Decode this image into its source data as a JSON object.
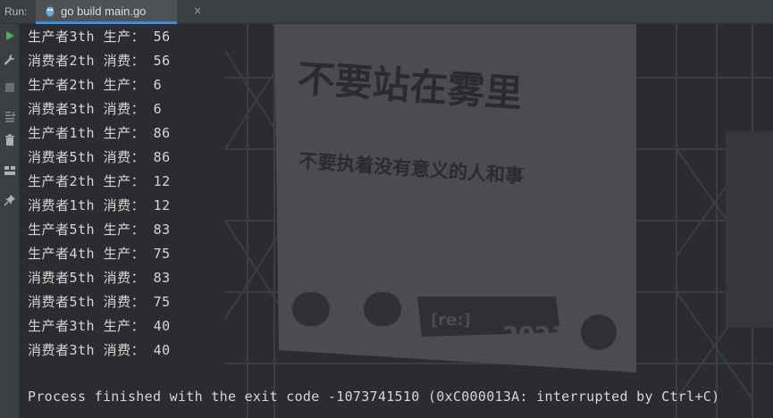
{
  "run_header": {
    "label": "Run:",
    "tab_title": "go build main.go",
    "close": "×"
  },
  "toolbar": {
    "buttons": [
      {
        "icon": "run-icon",
        "color": "#4caf50"
      },
      {
        "icon": "wrench-icon"
      },
      {
        "icon": "stop-icon"
      },
      {
        "icon": "scroll-to-end-icon"
      },
      {
        "icon": "trash-icon"
      },
      {
        "icon": "layout-icon"
      },
      {
        "icon": "pin-icon"
      }
    ]
  },
  "console": {
    "lines": [
      "生产者3th 生产： 56",
      "消费者2th 消费： 56",
      "生产者2th 生产： 6",
      "消费者3th 消费： 6",
      "生产者1th 生产： 86",
      "消费者5th 消费： 86",
      "生产者2th 生产： 12",
      "消费者1th 消费： 12",
      "生产者5th 生产： 83",
      "生产者4th 生产： 75",
      "消费者5th 消费： 83",
      "消费者5th 消费： 75",
      "生产者3th 生产： 40",
      "消费者3th 消费： 40"
    ],
    "exit_message": "Process finished with the exit code -1073741510 (0xC000013A: interrupted by Ctrl+C)"
  },
  "background": {
    "billboard_title": "不要站在雾里",
    "billboard_subtitle": "不要执着没有意义的人和事",
    "billboard_badge": "[re:]",
    "billboard_year": "2021"
  }
}
